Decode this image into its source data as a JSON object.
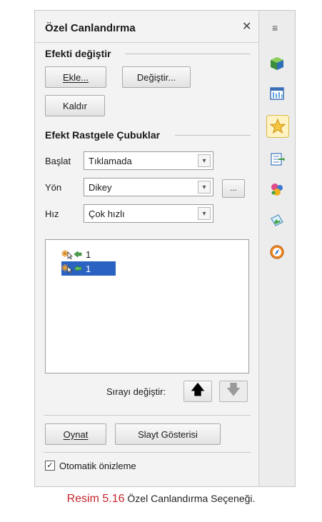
{
  "panel": {
    "title": "Özel Canlandırma",
    "close_glyph": "✕"
  },
  "modify": {
    "heading": "Efekti değiştir",
    "add_label": "Ekle...",
    "change_label": "Değiştir...",
    "remove_label": "Kaldır"
  },
  "effect": {
    "heading": "Efekt Rastgele Çubuklar",
    "start_label": "Başlat",
    "start_value": "Tıklamada",
    "direction_label": "Yön",
    "direction_value": "Dikey",
    "options_label": "...",
    "speed_label": "Hız",
    "speed_value": "Çok hızlı"
  },
  "list": {
    "items": [
      {
        "number": "1",
        "selected": false
      },
      {
        "number": "1",
        "selected": true
      }
    ]
  },
  "order": {
    "label": "Sırayı değiştir:"
  },
  "footer": {
    "play_label": "Oynat",
    "slideshow_label": "Slayt Gösterisi",
    "autopreview_label": "Otomatik önizleme",
    "autopreview_checked": true
  },
  "sidebar": {
    "menu_glyph": "≡",
    "icons": [
      "properties-icon",
      "slide-transition-icon",
      "custom-animation-icon",
      "master-slides-icon",
      "styles-icon",
      "gallery-icon",
      "navigator-icon"
    ]
  },
  "caption": {
    "prefix": "Resim 5.16",
    "text": "Özel Canlandırma Seçeneği."
  }
}
